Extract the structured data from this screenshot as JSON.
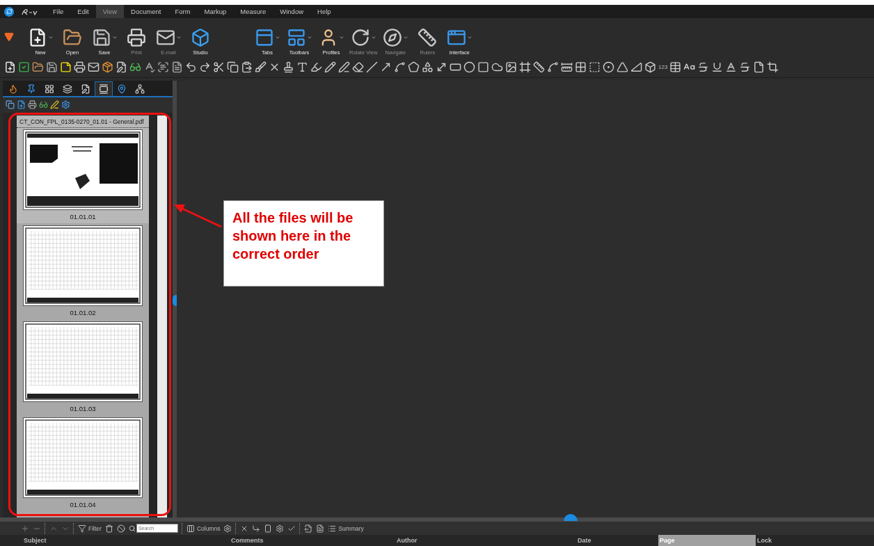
{
  "menu": {
    "items": [
      {
        "label": "File",
        "selected": false
      },
      {
        "label": "Edit",
        "selected": false
      },
      {
        "label": "View",
        "selected": true
      },
      {
        "label": "Document",
        "selected": false
      },
      {
        "label": "Form",
        "selected": false
      },
      {
        "label": "Markup",
        "selected": false
      },
      {
        "label": "Measure",
        "selected": false
      },
      {
        "label": "Window",
        "selected": false
      },
      {
        "label": "Help",
        "selected": false
      }
    ]
  },
  "ribbon": {
    "buttons": [
      {
        "kind": "new",
        "label": "New",
        "dimmed": false
      },
      {
        "kind": "open",
        "label": "Open",
        "dimmed": false
      },
      {
        "kind": "save",
        "label": "Save",
        "dimmed": false
      },
      {
        "kind": "print",
        "label": "Print",
        "dimmed": true
      },
      {
        "kind": "email",
        "label": "E-mail",
        "dimmed": true
      },
      {
        "kind": "studio",
        "label": "Studio",
        "dimmed": false
      },
      {
        "kind": "tabs",
        "label": "Tabs",
        "dimmed": false
      },
      {
        "kind": "toolbars",
        "label": "Toolbars",
        "dimmed": false
      },
      {
        "kind": "profiles",
        "label": "Profiles",
        "dimmed": false
      },
      {
        "kind": "rotate",
        "label": "Rotate View",
        "dimmed": true
      },
      {
        "kind": "navigate",
        "label": "Navigate",
        "dimmed": true
      },
      {
        "kind": "rulers",
        "label": "Rulers",
        "dimmed": true
      },
      {
        "kind": "interface",
        "label": "Interface",
        "dimmed": false
      }
    ]
  },
  "toolbar": {
    "count_tool": "123"
  },
  "panel": {
    "tabs": [
      {
        "selected": false
      },
      {
        "selected": false
      },
      {
        "selected": false
      },
      {
        "selected": false
      },
      {
        "selected": false
      },
      {
        "selected": true
      },
      {
        "selected": false
      },
      {
        "selected": false
      }
    ],
    "file_name": "CT_CON_FPL_0135-0270_01.01 - General.pdf",
    "pages": [
      {
        "kind": "title",
        "label": "01.01.01",
        "selected": true
      },
      {
        "kind": "table",
        "label": "01.01.02",
        "selected": false
      },
      {
        "kind": "table",
        "label": "01.01.03",
        "selected": false
      },
      {
        "kind": "table",
        "label": "01.01.04",
        "selected": false
      }
    ]
  },
  "callout": {
    "text": "All the files will be shown here in the correct order"
  },
  "markups": {
    "filter": "Filter",
    "search_placeholder": "Search",
    "columns_button": "Columns",
    "summary_button": "Summary",
    "columns": [
      {
        "label": "Subject",
        "selected": false
      },
      {
        "label": "Comments",
        "selected": false
      },
      {
        "label": "Author",
        "selected": false
      },
      {
        "label": "Date",
        "selected": false
      },
      {
        "label": "Page",
        "selected": true
      },
      {
        "label": "Lock",
        "selected": false
      }
    ]
  }
}
